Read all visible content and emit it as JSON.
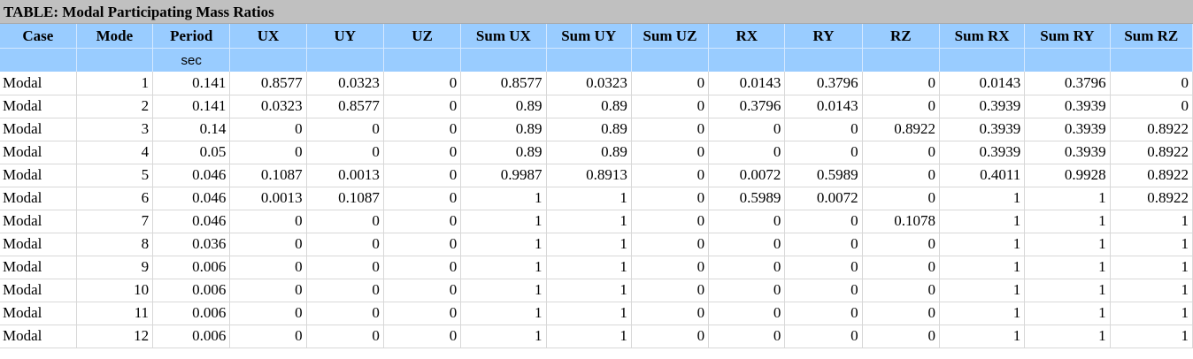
{
  "title": "TABLE:  Modal Participating Mass Ratios",
  "columns": [
    "Case",
    "Mode",
    "Period",
    "UX",
    "UY",
    "UZ",
    "Sum UX",
    "Sum UY",
    "Sum UZ",
    "RX",
    "RY",
    "RZ",
    "Sum RX",
    "Sum RY",
    "Sum RZ"
  ],
  "units": [
    "",
    "",
    "sec",
    "",
    "",
    "",
    "",
    "",
    "",
    "",
    "",
    "",
    "",
    "",
    ""
  ],
  "rows": [
    [
      "Modal",
      "1",
      "0.141",
      "0.8577",
      "0.0323",
      "0",
      "0.8577",
      "0.0323",
      "0",
      "0.0143",
      "0.3796",
      "0",
      "0.0143",
      "0.3796",
      "0"
    ],
    [
      "Modal",
      "2",
      "0.141",
      "0.0323",
      "0.8577",
      "0",
      "0.89",
      "0.89",
      "0",
      "0.3796",
      "0.0143",
      "0",
      "0.3939",
      "0.3939",
      "0"
    ],
    [
      "Modal",
      "3",
      "0.14",
      "0",
      "0",
      "0",
      "0.89",
      "0.89",
      "0",
      "0",
      "0",
      "0.8922",
      "0.3939",
      "0.3939",
      "0.8922"
    ],
    [
      "Modal",
      "4",
      "0.05",
      "0",
      "0",
      "0",
      "0.89",
      "0.89",
      "0",
      "0",
      "0",
      "0",
      "0.3939",
      "0.3939",
      "0.8922"
    ],
    [
      "Modal",
      "5",
      "0.046",
      "0.1087",
      "0.0013",
      "0",
      "0.9987",
      "0.8913",
      "0",
      "0.0072",
      "0.5989",
      "0",
      "0.4011",
      "0.9928",
      "0.8922"
    ],
    [
      "Modal",
      "6",
      "0.046",
      "0.0013",
      "0.1087",
      "0",
      "1",
      "1",
      "0",
      "0.5989",
      "0.0072",
      "0",
      "1",
      "1",
      "0.8922"
    ],
    [
      "Modal",
      "7",
      "0.046",
      "0",
      "0",
      "0",
      "1",
      "1",
      "0",
      "0",
      "0",
      "0.1078",
      "1",
      "1",
      "1"
    ],
    [
      "Modal",
      "8",
      "0.036",
      "0",
      "0",
      "0",
      "1",
      "1",
      "0",
      "0",
      "0",
      "0",
      "1",
      "1",
      "1"
    ],
    [
      "Modal",
      "9",
      "0.006",
      "0",
      "0",
      "0",
      "1",
      "1",
      "0",
      "0",
      "0",
      "0",
      "1",
      "1",
      "1"
    ],
    [
      "Modal",
      "10",
      "0.006",
      "0",
      "0",
      "0",
      "1",
      "1",
      "0",
      "0",
      "0",
      "0",
      "1",
      "1",
      "1"
    ],
    [
      "Modal",
      "11",
      "0.006",
      "0",
      "0",
      "0",
      "1",
      "1",
      "0",
      "0",
      "0",
      "0",
      "1",
      "1",
      "1"
    ],
    [
      "Modal",
      "12",
      "0.006",
      "0",
      "0",
      "0",
      "1",
      "1",
      "0",
      "0",
      "0",
      "0",
      "1",
      "1",
      "1"
    ]
  ]
}
